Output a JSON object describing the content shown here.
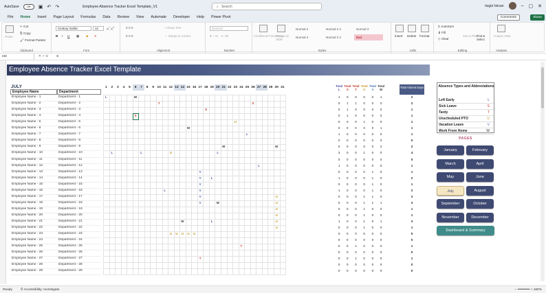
{
  "titlebar": {
    "autosave": "AutoSave",
    "toggle": "Off",
    "filename": "Employee Absence Tracker Excel Template_V1",
    "search": "Search",
    "user": "özgür bircan"
  },
  "menu": [
    "File",
    "Home",
    "Insert",
    "Page Layout",
    "Formulas",
    "Data",
    "Review",
    "View",
    "Automate",
    "Developer",
    "Help",
    "Power Pivot"
  ],
  "menu_active": "Home",
  "comments": "Comments",
  "share": "Share",
  "ribbon": {
    "clipboard": {
      "paste": "Paste",
      "cut": "Cut",
      "copy": "Copy",
      "painter": "Format Painter",
      "label": "Clipboard"
    },
    "font": {
      "name": "Century Gothic",
      "size": "12",
      "label": "Font"
    },
    "alignment": {
      "wrap": "Wrap Text",
      "merge": "Merge & Center",
      "label": "Alignment"
    },
    "number": {
      "format": "General",
      "label": "Number"
    },
    "styles": {
      "cond": "Conditional Formatting",
      "table": "Format as Table",
      "cells": [
        "Normal 2",
        "Normal 2 2",
        "Normal 3",
        "Normal 4",
        "Normal 2 2",
        "Bad"
      ],
      "label": "Styles"
    },
    "cells": {
      "insert": "Insert",
      "delete": "Delete",
      "format": "Format",
      "label": "Cells"
    },
    "editing": {
      "autosum": "AutoSum",
      "fill": "Fill",
      "clear": "Clear",
      "sort": "Sort & Filter",
      "find": "Find & Select",
      "label": "Editing"
    },
    "analysis": {
      "analyze": "Analyze Data",
      "label": "Analysis"
    }
  },
  "formula": {
    "cell": "I33",
    "value": "S"
  },
  "sheet": {
    "banner": "Employee Absence Tracker Excel Template",
    "month": "JULY",
    "col_employee": "Employee Name",
    "col_department": "Department",
    "days": [
      "1",
      "2",
      "3",
      "4",
      "5",
      "6",
      "7",
      "8",
      "9",
      "10",
      "11",
      "12",
      "13",
      "14",
      "15",
      "16",
      "17",
      "18",
      "19",
      "20",
      "21",
      "22",
      "23",
      "24",
      "25",
      "26",
      "27",
      "28",
      "29",
      "30",
      "31"
    ],
    "total_labels": [
      "Total",
      "Total",
      "Total",
      "Total",
      "Total",
      "Total"
    ],
    "total_codes": [
      "L",
      "S",
      "T",
      "U",
      "V",
      "W"
    ],
    "total_absent": "Total Absent Days",
    "rows": [
      {
        "name": "Employee Name - 1",
        "dept": "Department - 1",
        "t": [
          "1",
          "0",
          "0",
          "0",
          "0",
          "1"
        ],
        "abs": "2"
      },
      {
        "name": "Employee Name - 2",
        "dept": "Department - 2",
        "t": [
          "0",
          "1",
          "1",
          "0",
          "0",
          "0"
        ],
        "abs": "2"
      },
      {
        "name": "Employee Name - 3",
        "dept": "Department - 3",
        "t": [
          "0",
          "1",
          "0",
          "0",
          "0",
          "0"
        ],
        "abs": "1"
      },
      {
        "name": "Employee Name - 4",
        "dept": "Department - 4",
        "t": [
          "0",
          "1",
          "0",
          "0",
          "0",
          "0"
        ],
        "abs": "1"
      },
      {
        "name": "Employee Name - 5",
        "dept": "Department - 5",
        "t": [
          "0",
          "0",
          "0",
          "1",
          "0",
          "0"
        ],
        "abs": "1"
      },
      {
        "name": "Employee Name - 6",
        "dept": "Department - 6",
        "t": [
          "0",
          "0",
          "0",
          "0",
          "0",
          "1"
        ],
        "abs": "1"
      },
      {
        "name": "Employee Name - 7",
        "dept": "Department - 7",
        "t": [
          "1",
          "0",
          "0",
          "0",
          "0",
          "0"
        ],
        "abs": "1"
      },
      {
        "name": "Employee Name - 8",
        "dept": "Department - 8",
        "t": [
          "0",
          "0",
          "0",
          "0",
          "0",
          "0"
        ],
        "abs": "0"
      },
      {
        "name": "Employee Name - 9",
        "dept": "Department - 9",
        "t": [
          "0",
          "0",
          "0",
          "0",
          "0",
          "2"
        ],
        "abs": "2"
      },
      {
        "name": "Employee Name - 10",
        "dept": "Department - 10",
        "t": [
          "3",
          "0",
          "0",
          "1",
          "0",
          "0"
        ],
        "abs": "4"
      },
      {
        "name": "Employee Name - 11",
        "dept": "Department - 11",
        "t": [
          "0",
          "0",
          "0",
          "0",
          "0",
          "0"
        ],
        "abs": "0"
      },
      {
        "name": "Employee Name - 12",
        "dept": "Department - 12",
        "t": [
          "1",
          "0",
          "0",
          "0",
          "0",
          "0"
        ],
        "abs": "1"
      },
      {
        "name": "Employee Name - 13",
        "dept": "Department - 13",
        "t": [
          "0",
          "0",
          "0",
          "0",
          "1",
          "0"
        ],
        "abs": "1"
      },
      {
        "name": "Employee Name - 14",
        "dept": "Department - 14",
        "t": [
          "1",
          "0",
          "0",
          "0",
          "1",
          "0"
        ],
        "abs": "2"
      },
      {
        "name": "Employee Name - 15",
        "dept": "Department - 15",
        "t": [
          "0",
          "0",
          "0",
          "0",
          "1",
          "0"
        ],
        "abs": "1"
      },
      {
        "name": "Employee Name - 16",
        "dept": "Department - 16",
        "t": [
          "1",
          "0",
          "0",
          "0",
          "1",
          "0"
        ],
        "abs": "2"
      },
      {
        "name": "Employee Name - 17",
        "dept": "Department - 17",
        "t": [
          "0",
          "0",
          "0",
          "1",
          "1",
          "0"
        ],
        "abs": "2"
      },
      {
        "name": "Employee Name - 18",
        "dept": "Department - 18",
        "t": [
          "0",
          "0",
          "0",
          "1",
          "1",
          "1"
        ],
        "abs": "3"
      },
      {
        "name": "Employee Name - 19",
        "dept": "Department - 19",
        "t": [
          "0",
          "0",
          "0",
          "1",
          "0",
          "0"
        ],
        "abs": "1"
      },
      {
        "name": "Employee Name - 20",
        "dept": "Department - 20",
        "t": [
          "0",
          "0",
          "0",
          "1",
          "0",
          "0"
        ],
        "abs": "1"
      },
      {
        "name": "Employee Name - 21",
        "dept": "Department - 21",
        "t": [
          "1",
          "0",
          "0",
          "1",
          "0",
          "1"
        ],
        "abs": "3"
      },
      {
        "name": "Employee Name - 22",
        "dept": "Department - 22",
        "t": [
          "0",
          "0",
          "0",
          "1",
          "0",
          "0"
        ],
        "abs": "1"
      },
      {
        "name": "Employee Name - 23",
        "dept": "Department - 23",
        "t": [
          "0",
          "0",
          "0",
          "5",
          "0",
          "0"
        ],
        "abs": "5"
      },
      {
        "name": "Employee Name - 24",
        "dept": "Department - 24",
        "t": [
          "0",
          "0",
          "0",
          "0",
          "0",
          "0"
        ],
        "abs": "0"
      },
      {
        "name": "Employee Name - 25",
        "dept": "Department - 25",
        "t": [
          "0",
          "0",
          "1",
          "0",
          "0",
          "0"
        ],
        "abs": "1"
      },
      {
        "name": "Employee Name - 26",
        "dept": "Department - 26",
        "t": [
          "0",
          "0",
          "0",
          "0",
          "0",
          "0"
        ],
        "abs": "0"
      },
      {
        "name": "Employee Name - 27",
        "dept": "Department - 27",
        "t": [
          "0",
          "0",
          "1",
          "0",
          "0",
          "0"
        ],
        "abs": "1"
      },
      {
        "name": "Employee Name - 28",
        "dept": "Department - 28",
        "t": [
          "0",
          "0",
          "0",
          "0",
          "0",
          "0"
        ],
        "abs": "0"
      },
      {
        "name": "Employee Name - 29",
        "dept": "Department - 29",
        "t": [
          "0",
          "0",
          "0",
          "0",
          "0",
          "0"
        ],
        "abs": "0"
      }
    ],
    "marks": [
      {
        "r": 0,
        "d": 1,
        "v": "L"
      },
      {
        "r": 0,
        "d": 6,
        "v": "W"
      },
      {
        "r": 1,
        "d": 10,
        "v": "T"
      },
      {
        "r": 1,
        "d": 26,
        "v": "S"
      },
      {
        "r": 2,
        "d": 18,
        "v": "S"
      },
      {
        "r": 3,
        "d": 6,
        "v": "S"
      },
      {
        "r": 4,
        "d": 23,
        "v": "U"
      },
      {
        "r": 5,
        "d": 15,
        "v": "W"
      },
      {
        "r": 6,
        "d": 25,
        "v": "L"
      },
      {
        "r": 8,
        "d": 21,
        "v": "W"
      },
      {
        "r": 8,
        "d": 30,
        "v": "W"
      },
      {
        "r": 9,
        "d": 2,
        "v": "L"
      },
      {
        "r": 9,
        "d": 7,
        "v": "L"
      },
      {
        "r": 9,
        "d": 12,
        "v": "U"
      },
      {
        "r": 9,
        "d": 20,
        "v": "L"
      },
      {
        "r": 11,
        "d": 27,
        "v": "L"
      },
      {
        "r": 12,
        "d": 17,
        "v": "V"
      },
      {
        "r": 13,
        "d": 17,
        "v": "V"
      },
      {
        "r": 13,
        "d": 19,
        "v": "L"
      },
      {
        "r": 14,
        "d": 17,
        "v": "V"
      },
      {
        "r": 15,
        "d": 11,
        "v": "L"
      },
      {
        "r": 15,
        "d": 17,
        "v": "V"
      },
      {
        "r": 16,
        "d": 17,
        "v": "V"
      },
      {
        "r": 16,
        "d": 30,
        "v": "U"
      },
      {
        "r": 17,
        "d": 17,
        "v": "V"
      },
      {
        "r": 17,
        "d": 20,
        "v": "W"
      },
      {
        "r": 17,
        "d": 30,
        "v": "U"
      },
      {
        "r": 18,
        "d": 30,
        "v": "U"
      },
      {
        "r": 19,
        "d": 30,
        "v": "U"
      },
      {
        "r": 20,
        "d": 14,
        "v": "W"
      },
      {
        "r": 20,
        "d": 19,
        "v": "L"
      },
      {
        "r": 20,
        "d": 30,
        "v": "U"
      },
      {
        "r": 21,
        "d": 30,
        "v": "U"
      },
      {
        "r": 22,
        "d": 12,
        "v": "U"
      },
      {
        "r": 22,
        "d": 13,
        "v": "U"
      },
      {
        "r": 22,
        "d": 14,
        "v": "U"
      },
      {
        "r": 22,
        "d": 15,
        "v": "U"
      },
      {
        "r": 22,
        "d": 16,
        "v": "U"
      },
      {
        "r": 24,
        "d": 24,
        "v": "T"
      },
      {
        "r": 26,
        "d": 17,
        "v": "T"
      }
    ],
    "weekend_days": [
      6,
      7,
      13,
      14,
      20,
      21,
      27,
      28
    ],
    "legend": {
      "title": "Absence Types and Abbreviations",
      "items": [
        {
          "label": "Left Early",
          "code": "L"
        },
        {
          "label": "Sick Leave",
          "code": "S"
        },
        {
          "label": "Tardy",
          "code": "T"
        },
        {
          "label": "Unscheduled PTO",
          "code": "U"
        },
        {
          "label": "Vacation Leave",
          "code": "V"
        },
        {
          "label": "Work From Home",
          "code": "W"
        }
      ]
    },
    "pages_title": "PAGES",
    "months": [
      "January",
      "February",
      "March",
      "April",
      "May",
      "June",
      "July",
      "August",
      "September",
      "October",
      "November",
      "December"
    ],
    "active_month": "July",
    "dashboard": "Dashboard & Summary"
  },
  "status": {
    "ready": "Ready",
    "accessibility": "Accessibility: Investigate",
    "zoom": "160"
  },
  "colors": {
    "L": "#4a4f9e",
    "S": "#c0392b",
    "T": "#c0392b",
    "U": "#c79a2a",
    "V": "#4a6bb0",
    "W": "#333333",
    "weekend": "#d6deea"
  }
}
